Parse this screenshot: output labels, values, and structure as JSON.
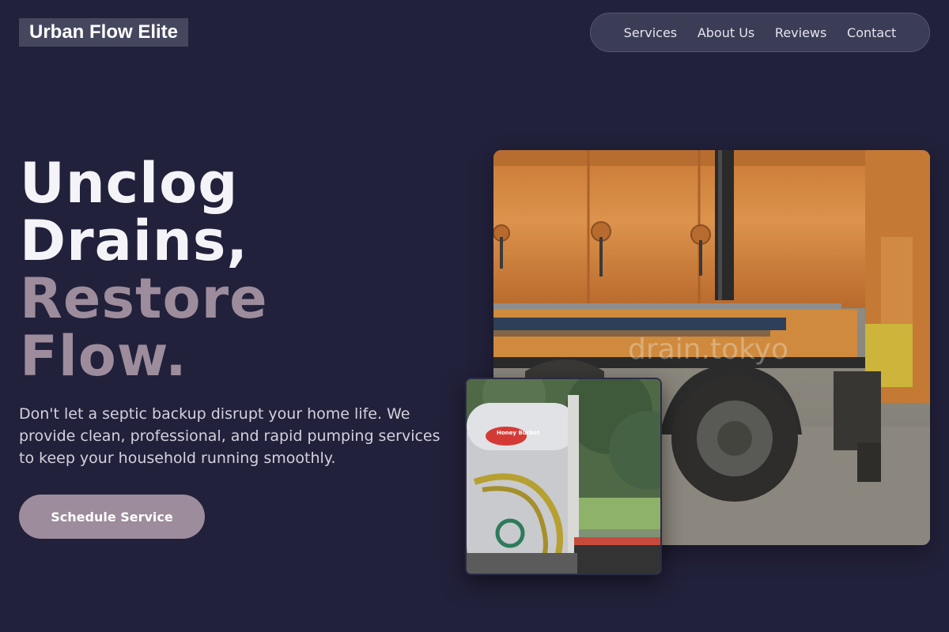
{
  "brand": {
    "name": "Urban Flow Elite"
  },
  "nav": {
    "items": [
      "Services",
      "About Us",
      "Reviews",
      "Contact"
    ]
  },
  "hero": {
    "headline_line1": "Unclog",
    "headline_line2": "Drains,",
    "headline_line3": "Restore",
    "headline_line4": "Flow.",
    "description": "Don't let a septic backup disrupt your home life. We provide clean, professional, and rapid pumping services to keep your household running smoothly.",
    "cta_label": "Schedule Service"
  },
  "images": {
    "main_watermark": "drain.tokyo",
    "small_tank_badge": "Honey Bucket"
  },
  "colors": {
    "background": "#22213b",
    "accent": "#9d8c9c",
    "nav_bg": "#3b3c56",
    "logo_bg": "#45475f"
  }
}
